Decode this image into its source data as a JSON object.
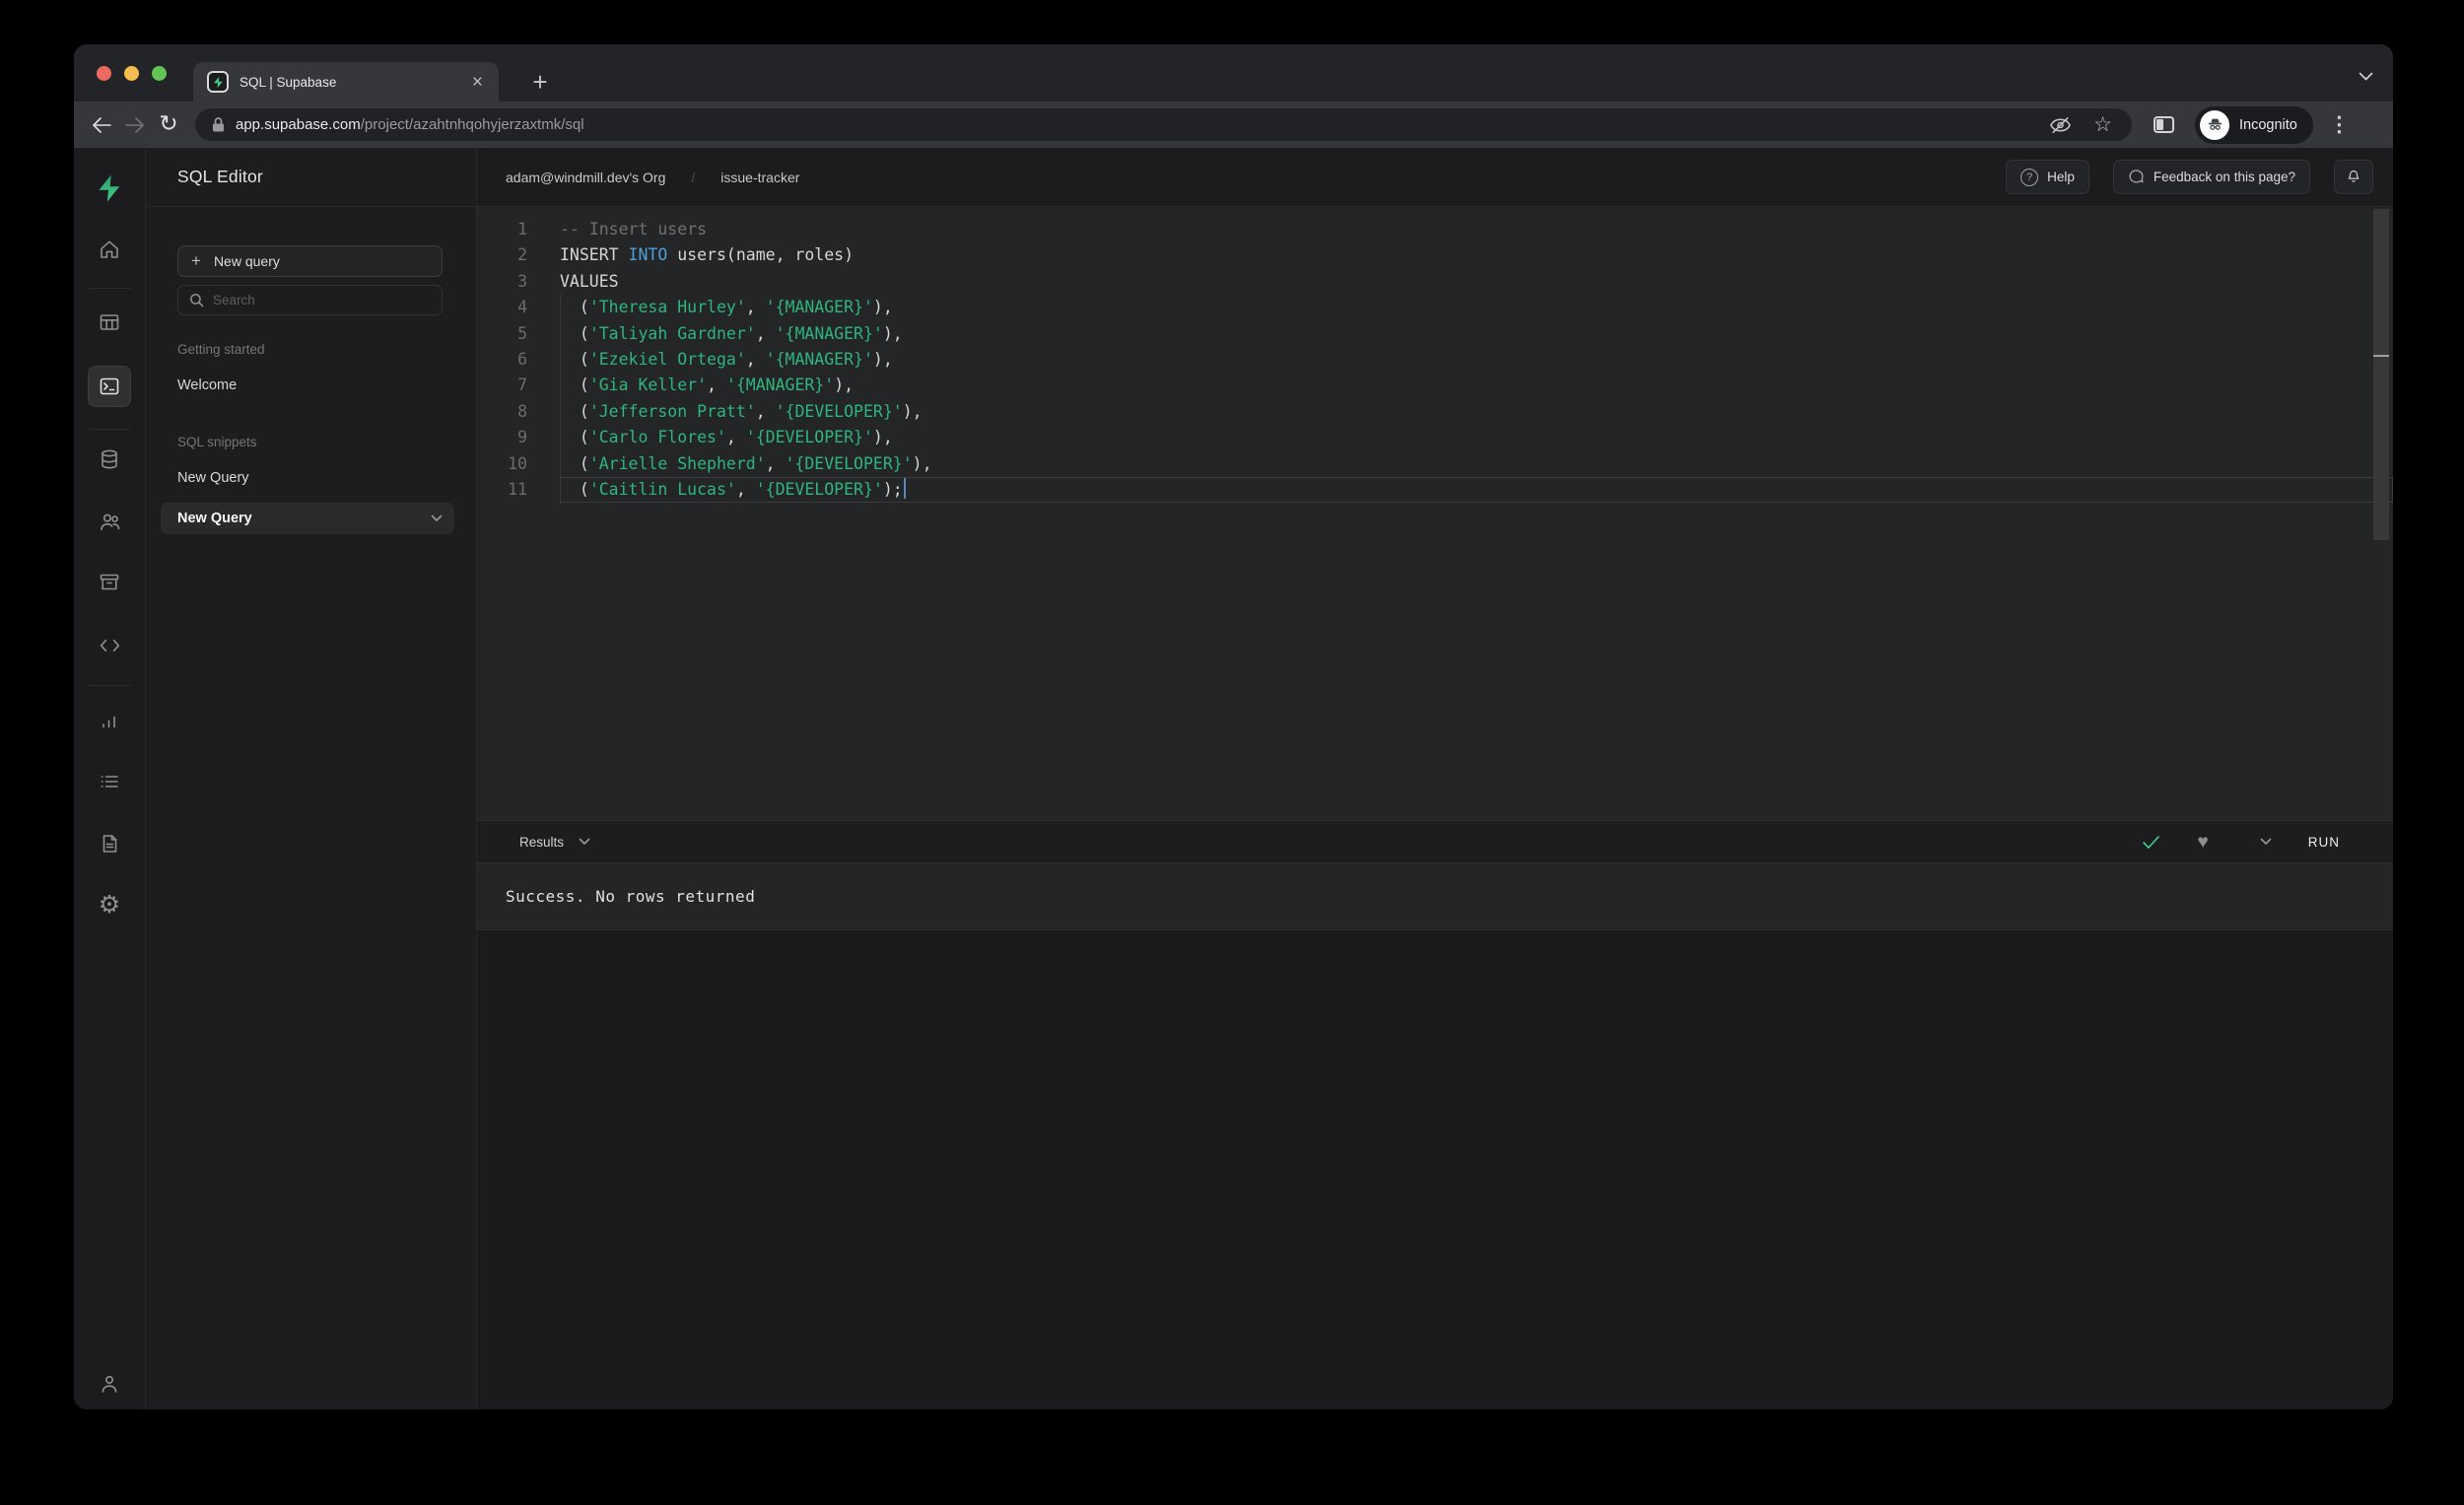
{
  "browser": {
    "tab_title": "SQL | Supabase",
    "url_domain": "app.supabase.com",
    "url_path": "/project/azahtnhqohyjerzaxtmk/sql",
    "incognito_label": "Incognito"
  },
  "icons": {
    "close": "×",
    "plus": "+",
    "reload": "↻",
    "star": "☆",
    "dots": "⋮",
    "gear": "⚙",
    "heart": "♥",
    "question": "?"
  },
  "sidebar": {
    "title": "SQL Editor",
    "new_query_button": "New query",
    "search_placeholder": "Search",
    "section1_label": "Getting started",
    "section1_item1": "Welcome",
    "section2_label": "SQL snippets",
    "section2_item1": "New Query",
    "selected_item": "New Query"
  },
  "header": {
    "breadcrumb_org": "adam@windmill.dev's Org",
    "breadcrumb_sep": "/",
    "breadcrumb_project": "issue-tracker",
    "help_button": "Help",
    "feedback_button": "Feedback on this page?"
  },
  "editor": {
    "lines": [
      {
        "num": 1,
        "tokens": [
          {
            "c": "cm",
            "t": "-- Insert users"
          }
        ]
      },
      {
        "num": 2,
        "tokens": [
          {
            "c": "pl",
            "t": "INSERT "
          },
          {
            "c": "kw",
            "t": "INTO"
          },
          {
            "c": "pl",
            "t": " users(name, roles)"
          }
        ]
      },
      {
        "num": 3,
        "tokens": [
          {
            "c": "pl",
            "t": "VALUES"
          }
        ]
      },
      {
        "num": 4,
        "tokens": [
          {
            "c": "pl",
            "t": "  ("
          },
          {
            "c": "str",
            "t": "'Theresa Hurley'"
          },
          {
            "c": "pl",
            "t": ", "
          },
          {
            "c": "str",
            "t": "'{MANAGER}'"
          },
          {
            "c": "pl",
            "t": "),"
          }
        ]
      },
      {
        "num": 5,
        "tokens": [
          {
            "c": "pl",
            "t": "  ("
          },
          {
            "c": "str",
            "t": "'Taliyah Gardner'"
          },
          {
            "c": "pl",
            "t": ", "
          },
          {
            "c": "str",
            "t": "'{MANAGER}'"
          },
          {
            "c": "pl",
            "t": "),"
          }
        ]
      },
      {
        "num": 6,
        "tokens": [
          {
            "c": "pl",
            "t": "  ("
          },
          {
            "c": "str",
            "t": "'Ezekiel Ortega'"
          },
          {
            "c": "pl",
            "t": ", "
          },
          {
            "c": "str",
            "t": "'{MANAGER}'"
          },
          {
            "c": "pl",
            "t": "),"
          }
        ]
      },
      {
        "num": 7,
        "tokens": [
          {
            "c": "pl",
            "t": "  ("
          },
          {
            "c": "str",
            "t": "'Gia Keller'"
          },
          {
            "c": "pl",
            "t": ", "
          },
          {
            "c": "str",
            "t": "'{MANAGER}'"
          },
          {
            "c": "pl",
            "t": "),"
          }
        ]
      },
      {
        "num": 8,
        "tokens": [
          {
            "c": "pl",
            "t": "  ("
          },
          {
            "c": "str",
            "t": "'Jefferson Pratt'"
          },
          {
            "c": "pl",
            "t": ", "
          },
          {
            "c": "str",
            "t": "'{DEVELOPER}'"
          },
          {
            "c": "pl",
            "t": "),"
          }
        ]
      },
      {
        "num": 9,
        "tokens": [
          {
            "c": "pl",
            "t": "  ("
          },
          {
            "c": "str",
            "t": "'Carlo Flores'"
          },
          {
            "c": "pl",
            "t": ", "
          },
          {
            "c": "str",
            "t": "'{DEVELOPER}'"
          },
          {
            "c": "pl",
            "t": "),"
          }
        ]
      },
      {
        "num": 10,
        "tokens": [
          {
            "c": "pl",
            "t": "  ("
          },
          {
            "c": "str",
            "t": "'Arielle Shepherd'"
          },
          {
            "c": "pl",
            "t": ", "
          },
          {
            "c": "str",
            "t": "'{DEVELOPER}'"
          },
          {
            "c": "pl",
            "t": "),"
          }
        ]
      },
      {
        "num": 11,
        "current": true,
        "cursor": true,
        "tokens": [
          {
            "c": "pl",
            "t": "  ("
          },
          {
            "c": "str",
            "t": "'Caitlin Lucas'"
          },
          {
            "c": "pl",
            "t": ", "
          },
          {
            "c": "str",
            "t": "'{DEVELOPER}'"
          },
          {
            "c": "pl",
            "t": ");"
          }
        ]
      }
    ]
  },
  "results": {
    "label": "Results",
    "run_button": "RUN",
    "message": "Success. No rows returned"
  },
  "colors": {
    "accent": "#3ecf8e",
    "keyword": "#4f9fd8",
    "string": "#2eb57e"
  }
}
